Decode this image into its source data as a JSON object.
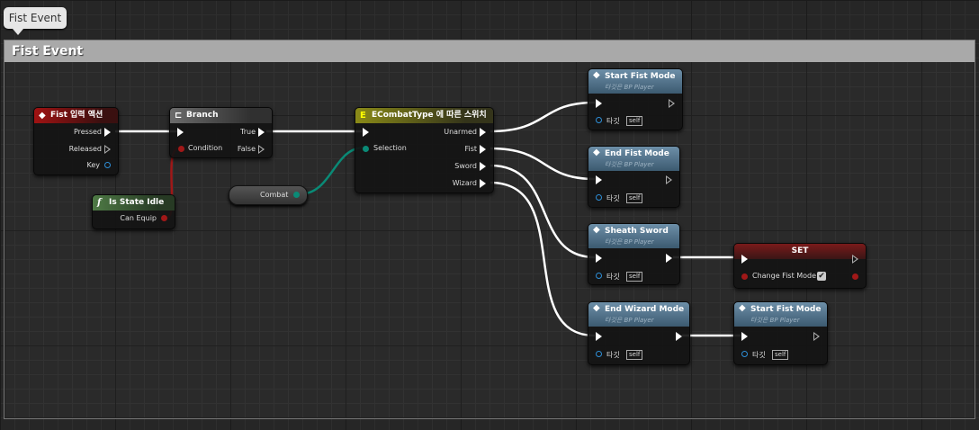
{
  "tab": {
    "title": "Fist Event"
  },
  "comment": {
    "title": "Fist Event"
  },
  "nodes": {
    "fist_input": {
      "title": "Fist 입력 액션",
      "pressed": "Pressed",
      "released": "Released",
      "key": "Key"
    },
    "branch": {
      "title": "Branch",
      "condition": "Condition",
      "true_label": "True",
      "false_label": "False"
    },
    "is_state_idle": {
      "title": "Is State Idle",
      "output": "Can Equip"
    },
    "combat_var": {
      "label": "Combat"
    },
    "switch": {
      "title": "ECombatType 에 따른 스위치",
      "selection": "Selection",
      "unarmed": "Unarmed",
      "fist": "Fist",
      "sword": "Sword",
      "wizard": "Wizard"
    },
    "start_fist_1": {
      "title": "Start Fist Mode",
      "subtitle": "타깃은 BP Player",
      "target": "타깃",
      "self": "self"
    },
    "end_fist": {
      "title": "End Fist Mode",
      "subtitle": "타깃은 BP Player",
      "target": "타깃",
      "self": "self"
    },
    "sheath_sword": {
      "title": "Sheath Sword",
      "subtitle": "타깃은 BP Player",
      "target": "타깃",
      "self": "self"
    },
    "set_node": {
      "title": "SET",
      "var": "Change Fist Mode",
      "check": "✔"
    },
    "end_wizard": {
      "title": "End Wizard Mode",
      "subtitle": "타깃은 BP Player",
      "target": "타깃",
      "self": "self"
    },
    "start_fist_2": {
      "title": "Start Fist Mode",
      "subtitle": "타깃은 BP Player",
      "target": "타깃",
      "self": "self"
    }
  },
  "icons": {
    "event": "diamond-icon",
    "branch": "branch-icon",
    "function": "function-icon",
    "switch": "switch-icon"
  },
  "colors": {
    "exec": "#ffffff",
    "bool": "#a01818",
    "enum": "#0a8a76",
    "object": "#2e8fd8"
  }
}
